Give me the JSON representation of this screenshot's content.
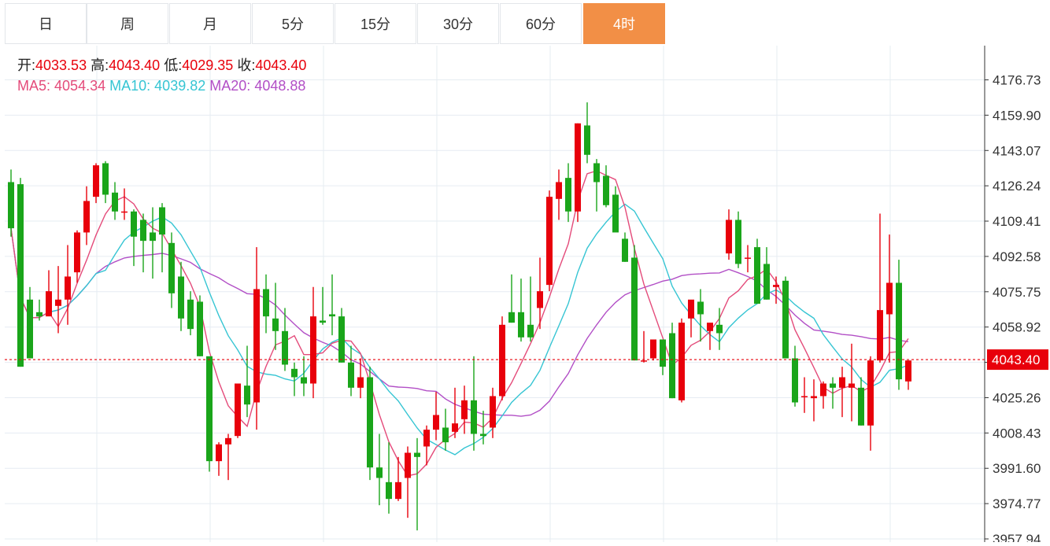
{
  "tabs": [
    {
      "label": "日",
      "active": false
    },
    {
      "label": "周",
      "active": false
    },
    {
      "label": "月",
      "active": false
    },
    {
      "label": "5分",
      "active": false
    },
    {
      "label": "15分",
      "active": false
    },
    {
      "label": "30分",
      "active": false
    },
    {
      "label": "60分",
      "active": false
    },
    {
      "label": "4时",
      "active": true
    }
  ],
  "legend": {
    "open_label": "开:",
    "open": "4033.53",
    "high_label": "高:",
    "high": "4043.40",
    "low_label": "低:",
    "low": "4029.35",
    "close_label": "收:",
    "close": "4043.40",
    "ma5_label": "MA5:",
    "ma5": "4054.34",
    "ma10_label": "MA10:",
    "ma10": "4039.82",
    "ma20_label": "MA20:",
    "ma20": "4048.88"
  },
  "colors": {
    "up": "#e8000b",
    "down": "#1aa51a",
    "ma5": "#e44b7a",
    "ma10": "#36c5d3",
    "ma20": "#b24fc6",
    "grid": "#e6ecf2",
    "active_tab": "#f28f46",
    "last_price_line": "#e8000b"
  },
  "chart_data": {
    "type": "candlestick",
    "yticks": [
      "4176.73",
      "4159.90",
      "4143.07",
      "4126.24",
      "4109.41",
      "4092.58",
      "4075.75",
      "4058.92",
      "4042.09",
      "4025.26",
      "4008.43",
      "3991.60",
      "3974.77",
      "3957.94"
    ],
    "ylim": [
      3957.94,
      4186.5
    ],
    "last_price": "4043.40",
    "candles": [
      [
        4128,
        4134,
        4102,
        4106
      ],
      [
        4127,
        4130,
        4040,
        4040
      ],
      [
        4072,
        4078,
        4045,
        4044
      ],
      [
        4066,
        4072,
        4062,
        4064
      ],
      [
        4064,
        4086,
        4065,
        4076
      ],
      [
        4069,
        4088,
        4056,
        4072
      ],
      [
        4072,
        4098,
        4060,
        4083
      ],
      [
        4085,
        4105,
        4080,
        4104
      ],
      [
        4104,
        4126,
        4098,
        4119
      ],
      [
        4121,
        4137,
        4118,
        4136
      ],
      [
        4137,
        4138,
        4118,
        4122
      ],
      [
        4123,
        4128,
        4110,
        4114
      ],
      [
        4114,
        4125,
        4110,
        4114
      ],
      [
        4114,
        4115,
        4088,
        4102
      ],
      [
        4110,
        4113,
        4085,
        4100
      ],
      [
        4104,
        4116,
        4082,
        4100
      ],
      [
        4116,
        4118,
        4085,
        4103
      ],
      [
        4099,
        4104,
        4068,
        4075
      ],
      [
        4083,
        4090,
        4057,
        4063
      ],
      [
        4072,
        4076,
        4055,
        4058
      ],
      [
        4071,
        4074,
        4045,
        4045
      ],
      [
        4045,
        4044,
        3990,
        3995
      ],
      [
        3995,
        4004,
        3988,
        4003
      ],
      [
        4003,
        4008,
        3986,
        4006
      ],
      [
        4007,
        4032,
        4006,
        4032
      ],
      [
        4031,
        4050,
        4016,
        4022
      ],
      [
        4023,
        4097,
        4010,
        4077
      ],
      [
        4077,
        4084,
        4056,
        4064
      ],
      [
        4063,
        4080,
        4048,
        4057
      ],
      [
        4057,
        4068,
        4038,
        4041
      ],
      [
        4039,
        4042,
        4026,
        4035
      ],
      [
        4035,
        4045,
        4026,
        4032
      ],
      [
        4032,
        4078,
        4025,
        4064
      ],
      [
        4062,
        4078,
        4060,
        4061
      ],
      [
        4065,
        4084,
        4055,
        4064
      ],
      [
        4064,
        4068,
        4042,
        4042
      ],
      [
        4042,
        4050,
        4026,
        4030
      ],
      [
        4030,
        4044,
        4025,
        4035
      ],
      [
        4035,
        4040,
        3986,
        3992
      ],
      [
        3992,
        4008,
        3974,
        3987
      ],
      [
        3985,
        4004,
        3970,
        3977
      ],
      [
        3977,
        3997,
        3976,
        3985
      ],
      [
        3987,
        4002,
        3968,
        3999
      ],
      [
        3999,
        4006,
        3962,
        3997
      ],
      [
        4002,
        4012,
        3993,
        4010
      ],
      [
        4010,
        4028,
        4005,
        4017
      ],
      [
        4011,
        4020,
        4000,
        4004
      ],
      [
        4009,
        4030,
        4006,
        4013
      ],
      [
        4015,
        4031,
        4008,
        4024
      ],
      [
        4024,
        4045,
        4000,
        4008
      ],
      [
        4008,
        4019,
        4003,
        4007
      ],
      [
        4011,
        4030,
        4006,
        4026
      ],
      [
        4026,
        4064,
        4024,
        4060
      ],
      [
        4066,
        4084,
        4061,
        4061
      ],
      [
        4066,
        4082,
        4052,
        4054
      ],
      [
        4060,
        4083,
        4052,
        4054
      ],
      [
        4068,
        4092,
        4058,
        4076
      ],
      [
        4079,
        4124,
        4076,
        4121
      ],
      [
        4120,
        4134,
        4110,
        4128
      ],
      [
        4130,
        4137,
        4109,
        4114
      ],
      [
        4114,
        4156,
        4109,
        4156
      ],
      [
        4155,
        4166,
        4137,
        4141
      ],
      [
        4137,
        4139,
        4114,
        4128
      ],
      [
        4131,
        4136,
        4116,
        4117
      ],
      [
        4122,
        4126,
        4109,
        4104
      ],
      [
        4101,
        4104,
        4090,
        4090
      ],
      [
        4092,
        4098,
        4043,
        4043
      ],
      [
        4043,
        4057,
        4042,
        4043
      ],
      [
        4044,
        4053,
        4043,
        4053
      ],
      [
        4053,
        4053,
        4036,
        4040
      ],
      [
        4056,
        4061,
        4025,
        4025
      ],
      [
        4024,
        4063,
        4023,
        4061
      ],
      [
        4063,
        4070,
        4054,
        4072
      ],
      [
        4071,
        4077,
        4052,
        4065
      ],
      [
        4057,
        4059,
        4048,
        4061
      ],
      [
        4060,
        4068,
        4048,
        4056
      ],
      [
        4094,
        4115,
        4091,
        4110
      ],
      [
        4110,
        4114,
        4087,
        4089
      ],
      [
        4092,
        4098,
        4085,
        4092
      ],
      [
        4097,
        4101,
        4075,
        4070
      ],
      [
        4089,
        4097,
        4072,
        4072
      ],
      [
        4078,
        4083,
        4070,
        4079
      ],
      [
        4081,
        4083,
        4044,
        4044
      ],
      [
        4044,
        4050,
        4021,
        4023
      ],
      [
        4026,
        4035,
        4018,
        4026
      ],
      [
        4025,
        4034,
        4014,
        4026
      ],
      [
        4026,
        4033,
        4020,
        4032
      ],
      [
        4032,
        4035,
        4020,
        4030
      ],
      [
        4030,
        4040,
        4016,
        4035
      ],
      [
        4030,
        4051,
        4014,
        4032
      ],
      [
        4030,
        4035,
        4012,
        4012
      ],
      [
        4012,
        4045,
        4000,
        4043
      ],
      [
        4043,
        4113,
        4042,
        4067
      ],
      [
        4065,
        4103,
        4042,
        4080
      ],
      [
        4080,
        4091,
        4029,
        4034
      ],
      [
        4033,
        4043,
        4029,
        4043
      ]
    ]
  }
}
